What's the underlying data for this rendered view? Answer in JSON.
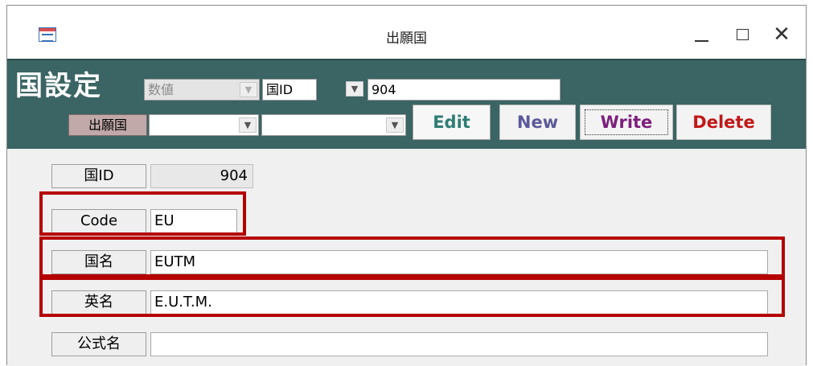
{
  "window": {
    "title": "出願国"
  },
  "header": {
    "form_title": "国設定",
    "filter_type": "数値",
    "filter_field": "国ID",
    "filter_value": "904",
    "country_label": "出願国",
    "country_combo1": "",
    "country_combo2": ""
  },
  "buttons": {
    "edit": "Edit",
    "new": "New",
    "write": "Write",
    "delete": "Delete"
  },
  "fields": {
    "country_id": {
      "label": "国ID",
      "value": "904"
    },
    "code": {
      "label": "Code",
      "value": "EU"
    },
    "country_name": {
      "label": "国名",
      "value": "EUTM"
    },
    "english_name": {
      "label": "英名",
      "value": "E.U.T.M."
    },
    "official_name": {
      "label": "公式名",
      "value": ""
    }
  },
  "colors": {
    "header_bg": "#3b6464",
    "highlight": "#b50000"
  }
}
